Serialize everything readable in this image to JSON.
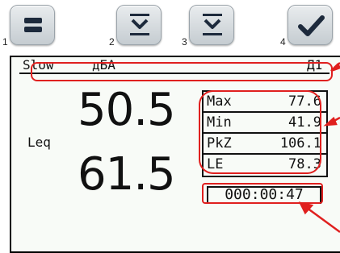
{
  "buttons": [
    {
      "number": "1",
      "icon": "menu-icon"
    },
    {
      "number": "2",
      "icon": "collapse-icon"
    },
    {
      "number": "3",
      "icon": "collapse-icon"
    },
    {
      "number": "4",
      "icon": "checkmark-icon"
    }
  ],
  "status": {
    "mode": "Slow",
    "weighting": "дБА",
    "range": "Д1"
  },
  "main": {
    "value_top": "50.5",
    "label": "Leq",
    "value_bottom": "61.5"
  },
  "stats": [
    {
      "label": "Max",
      "value": "77.6"
    },
    {
      "label": "Min",
      "value": "41.9"
    },
    {
      "label": "PkZ",
      "value": "106.1"
    },
    {
      "label": "LE",
      "value": "78.3"
    }
  ],
  "timer": "000:00:47",
  "colors": {
    "highlight": "#e0201f",
    "screen_bg": "#f8fbf7",
    "button_icon": "#1d2a3c"
  }
}
